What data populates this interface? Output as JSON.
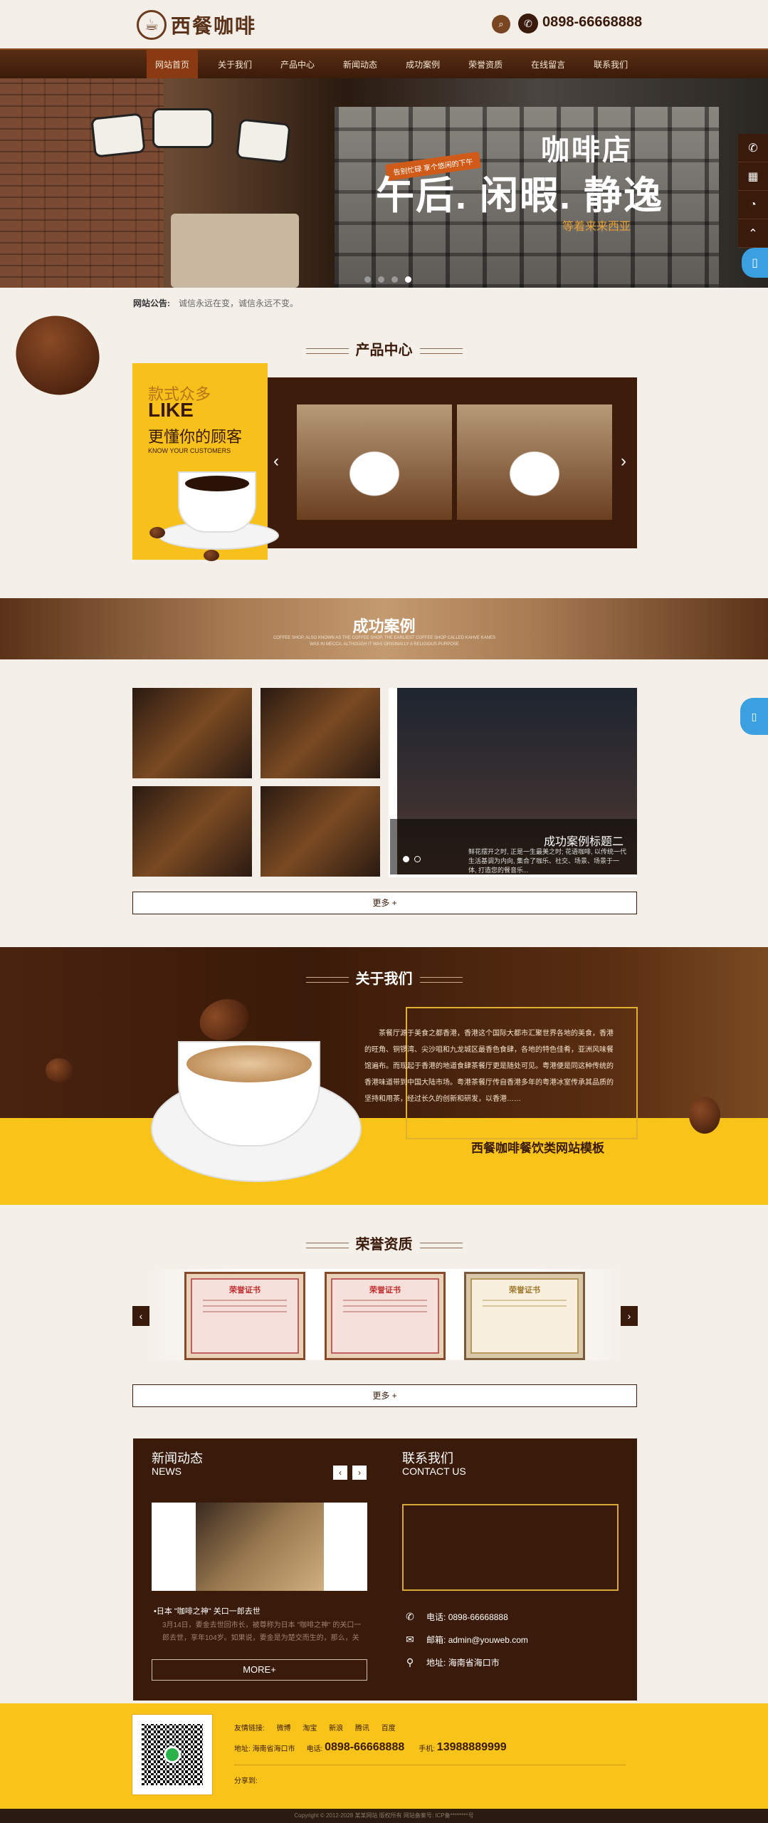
{
  "header": {
    "logo_text": "西餐咖啡",
    "phone": "0898-66668888"
  },
  "nav": {
    "items": [
      {
        "label": "网站首页"
      },
      {
        "label": "关于我们"
      },
      {
        "label": "产品中心"
      },
      {
        "label": "新闻动态"
      },
      {
        "label": "成功案例"
      },
      {
        "label": "荣誉资质"
      },
      {
        "label": "在线留言"
      },
      {
        "label": "联系我们"
      }
    ]
  },
  "banner": {
    "tag": "告别忙碌 享个悠闲的下午",
    "title1": "咖啡店",
    "title2": "午后. 闲暇. 静逸",
    "subtitle": "等着来来西亚"
  },
  "notice": {
    "label": "网站公告:",
    "text": "诚信永远在变，诚信永远不变。"
  },
  "products": {
    "title": "产品中心",
    "promo_line1": "款式众多",
    "promo_line2": "LIKE",
    "promo_line3": "更懂你的顾客",
    "promo_line4": "KNOW YOUR CUSTOMERS"
  },
  "cases": {
    "title": "成功案例",
    "subtitle": "COFFEE SHOP, ALSO KNOWN AS THE COFFEE SHOP. THE EARLIEST COFFEE SHOP CALLED KAHVE KANES WAS IN MECCA, ALTHOUGH IT WAS ORIGINALLY A RELIGIOUS PURPOSE",
    "big_caption": "成功案例标题二",
    "big_desc": "鲜花摆开之时, 正是一生最美之时; 花语咖啡, 以传统一代生活基调为内向, 集合了咖乐、社交、场景、场景于一体, 打造您的餐音乐...",
    "more": "更多 +"
  },
  "about": {
    "title": "关于我们",
    "text": "茶餐厅源于美食之都香港，香港这个国际大都市汇聚世界各地的美食，香港的旺角、铜锣湾、尖沙咀和九龙城区最香色食肆，各地的特色佳肴，亚洲风味餐馆遍布。而现起于香港的地道食肆茶餐厅更是随处可见。粤港便是同这种传统的香港味道带到中国大陆市场。粤港茶餐厅传自香港多年的粤港冰室传承其品质的坚持和用茶，经过长久的创新和研发，以香港……",
    "slogan": "西餐咖啡餐饮类网站模板"
  },
  "honors": {
    "title": "荣誉资质",
    "certs": [
      {
        "title": "荣誉证书"
      },
      {
        "title": "荣誉证书"
      },
      {
        "title": "荣誉证书"
      }
    ],
    "more": "更多 +"
  },
  "news": {
    "title": "新闻动态",
    "title_en": "NEWS",
    "headline": "•日本 \"咖啡之神\" 关口一郎去世",
    "desc": "3月14日，要金去世回市长，被尊称为日本 \"咖啡之神\" 的关口一郎去世，享年104岁。如果说，要金是为楚交而生的，那么，关",
    "more": "MORE+"
  },
  "contact": {
    "title": "联系我们",
    "title_en": "CONTACT US",
    "phone_label": "电话:",
    "phone": "0898-66668888",
    "email_label": "邮箱:",
    "email": "admin@youweb.com",
    "addr_label": "地址:",
    "addr": "海南省海口市"
  },
  "footer": {
    "links_label": "友情链接:",
    "links": [
      "微博",
      "淘宝",
      "新浪",
      "腾讯",
      "百度"
    ],
    "addr_label": "地址:",
    "addr": "海南省海口市",
    "tel_label": "电话:",
    "tel": "0898-66668888",
    "mobile_label": "手机:",
    "mobile": "13988889999",
    "share_label": "分享到:",
    "copyright": "Copyright © 2012-2028 某某网站 版权所有     网站备案号: ICP备********号"
  },
  "colors": {
    "brand_brown": "#3a1a0a",
    "accent_yellow": "#f8c41a",
    "nav_active": "#8a3a12"
  }
}
